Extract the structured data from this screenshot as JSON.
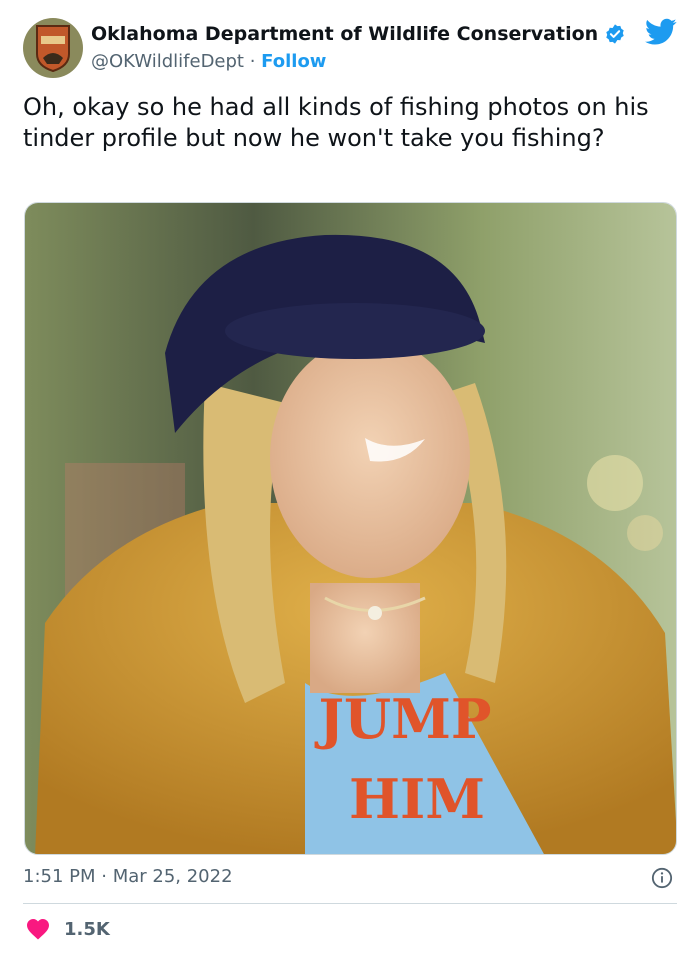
{
  "account": {
    "name": "Oklahoma Department of Wildlife Conservation",
    "handle": "@OKWildlifeDept",
    "separator": " · ",
    "follow_label": "Follow",
    "avatar_icon": "odwc-badge-icon"
  },
  "tweet": {
    "text": "Oh, okay so he had all kinds of fishing photos on his tinder profile but now he won't take you fishing?"
  },
  "media": {
    "shirt_text_line1": "JUMP",
    "shirt_text_line2": "HIM"
  },
  "meta": {
    "time": "1:51 PM",
    "separator": " · ",
    "date": "Mar 25, 2022"
  },
  "engagement": {
    "likes": "1.5K"
  },
  "colors": {
    "link": "#1d9bf0",
    "like": "#f91880",
    "muted": "#536471"
  },
  "icons": {
    "verified": "verified-badge-icon",
    "twitter": "twitter-bird-icon",
    "info": "info-icon",
    "heart": "heart-icon"
  }
}
